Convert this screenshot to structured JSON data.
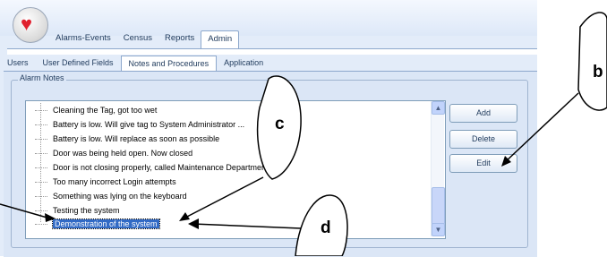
{
  "ribbon_tabs": [
    "Alarms-Events",
    "Census",
    "Reports",
    "Admin"
  ],
  "active_ribbon_tab": "Admin",
  "sub_tabs": [
    "Users",
    "User Defined Fields",
    "Notes and Procedures",
    "Application"
  ],
  "active_sub_tab": "Notes and Procedures",
  "group_label": "Alarm Notes",
  "notes": [
    "Cleaning the Tag, got too wet",
    "Battery is low. Will give tag to System Administrator ...",
    "Battery is low. Will replace as soon as possible",
    "Door was being held open. Now closed",
    "Door is not closing properly, called Maintenance Department",
    "Too many incorrect Login attempts",
    "Something was lying on the keyboard",
    "Testing the system",
    "Demonstration of the system"
  ],
  "selected_note": "Demonstration of the system",
  "buttons": {
    "add": "Add",
    "delete": "Delete",
    "edit": "Edit"
  },
  "icons": {
    "logo": "heart-logo-icon",
    "scroll_up": "scroll-up-arrow-icon",
    "scroll_down": "scroll-down-arrow-icon"
  },
  "callouts": {
    "b": "b",
    "c": "c",
    "d": "d"
  },
  "colors": {
    "selection": "#316ac5",
    "heart": "#e0202e"
  }
}
